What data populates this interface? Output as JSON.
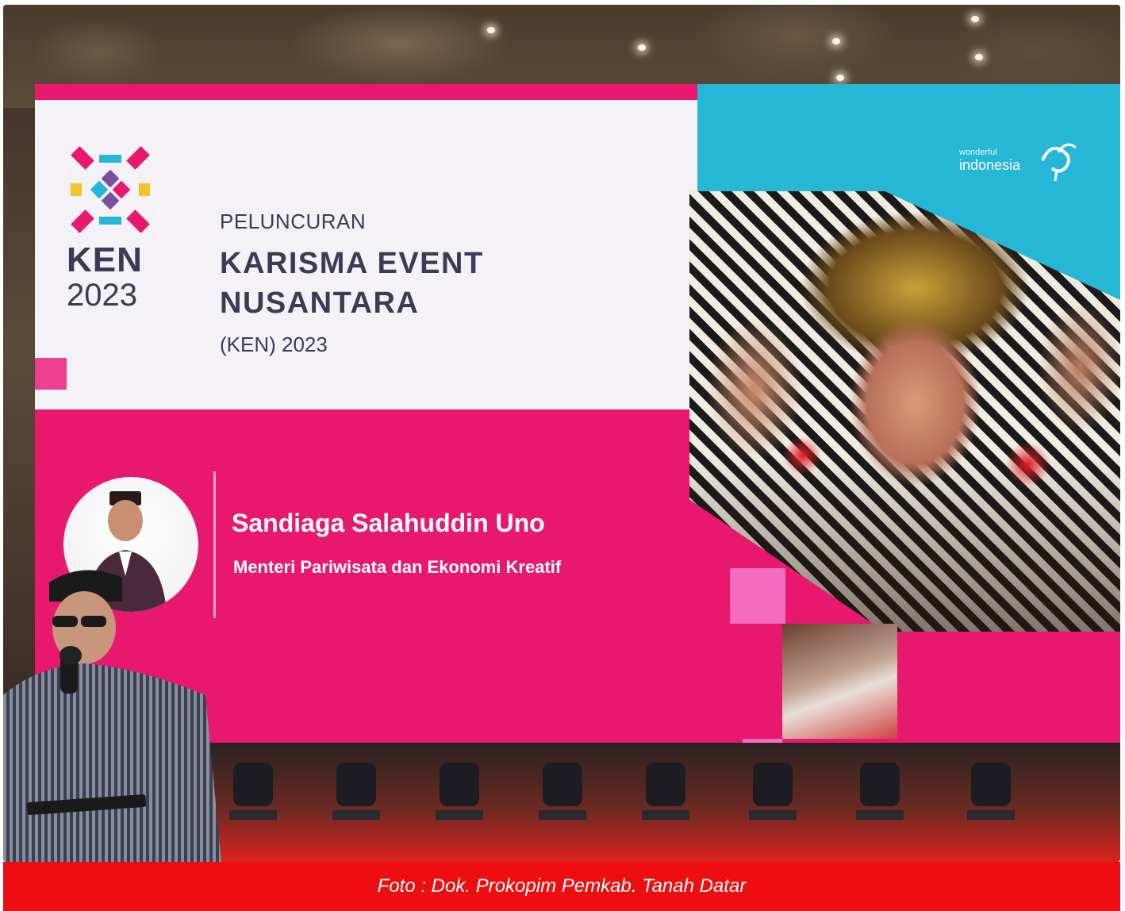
{
  "screen": {
    "logo_line1": "KEN",
    "logo_line2": "2023",
    "pre_title": "PELUNCURAN",
    "title_line1": "KARISMA EVENT",
    "title_line2": "NUSANTARA",
    "sub_title": "(KEN) 2023",
    "brand_small": "wonderful",
    "brand_name": "indonesia",
    "speaker_name": "Sandiaga Salahuddin Uno",
    "speaker_role": "Menteri Pariwisata dan Ekonomi Kreatif"
  },
  "caption": "Foto : Dok. Prokopim Pemkab. Tanah Datar",
  "colors": {
    "screen_pink": "#e8186e",
    "screen_cyan": "#27b7d6",
    "caption_red": "#ee0d10",
    "title_navy": "#3c3a56"
  }
}
